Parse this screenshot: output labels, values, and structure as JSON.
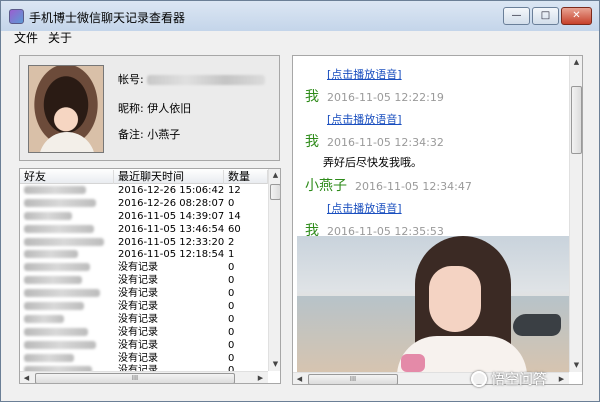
{
  "window": {
    "title": "手机博士微信聊天记录查看器",
    "buttons": {
      "minimize": "—",
      "maximize": "□",
      "close": "✕"
    }
  },
  "menu": {
    "file": "文件",
    "about": "关于"
  },
  "profile": {
    "account_label": "帐号:",
    "nickname_label": "昵称:",
    "nickname": "伊人依旧",
    "remark_label": "备注:",
    "remark": "小燕子"
  },
  "friends": {
    "headers": {
      "friend": "好友",
      "last_time": "最近聊天时间",
      "count": "数量"
    },
    "rows": [
      {
        "friend": "",
        "time": "2016-12-26 15:06:42",
        "count": "12"
      },
      {
        "friend": "",
        "time": "2016-12-26 08:28:07",
        "count": "0"
      },
      {
        "friend": "",
        "time": "2016-11-05 14:39:07",
        "count": "14"
      },
      {
        "friend": "",
        "time": "2016-11-05 13:46:54",
        "count": "60"
      },
      {
        "friend": "",
        "time": "2016-11-05 12:33:20",
        "count": "2"
      },
      {
        "friend": "",
        "time": "2016-11-05 12:18:54",
        "count": "1"
      },
      {
        "friend": "",
        "time": "没有记录",
        "count": "0"
      },
      {
        "friend": "",
        "time": "没有记录",
        "count": "0"
      },
      {
        "friend": "",
        "time": "没有记录",
        "count": "0"
      },
      {
        "friend": "",
        "time": "没有记录",
        "count": "0"
      },
      {
        "friend": "",
        "time": "没有记录",
        "count": "0"
      },
      {
        "friend": "",
        "time": "没有记录",
        "count": "0"
      },
      {
        "friend": "",
        "time": "没有记录",
        "count": "0"
      },
      {
        "friend": "",
        "time": "没有记录",
        "count": "0"
      },
      {
        "friend": "",
        "time": "没有记录",
        "count": "0"
      }
    ],
    "hscroll_thumb": "III"
  },
  "chat": {
    "messages": [
      {
        "voice": "[点击播放语音]"
      },
      {
        "sender": "我",
        "time": "2016-11-05 12:22:19"
      },
      {
        "voice": "[点击播放语音]"
      },
      {
        "sender": "我",
        "time": "2016-11-05 12:34:32"
      },
      {
        "text": "弄好后尽快发我哦。"
      },
      {
        "sender": "小燕子",
        "time": "2016-11-05 12:34:47"
      },
      {
        "voice": "[点击播放语音]"
      },
      {
        "sender": "我",
        "time": "2016-11-05 12:35:53"
      }
    ],
    "hscroll_thumb": "III"
  },
  "watermark": {
    "text": "悟空问答"
  },
  "icons": [
    "app-icon",
    "chevron-up-icon",
    "chevron-down-icon",
    "chevron-left-icon",
    "chevron-right-icon"
  ]
}
